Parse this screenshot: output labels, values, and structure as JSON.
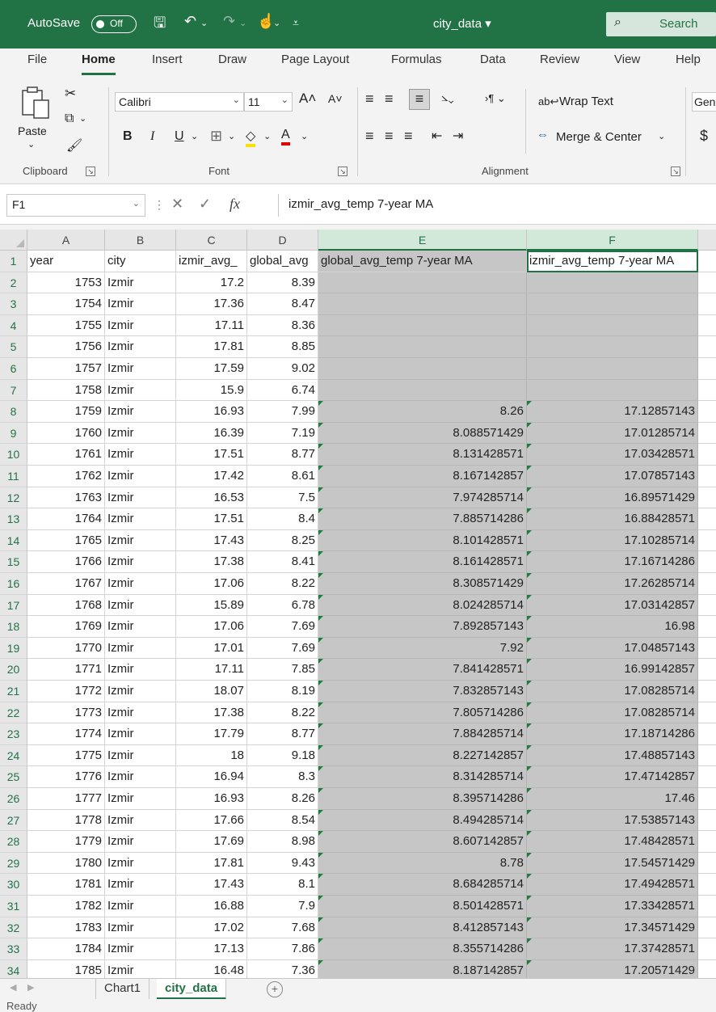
{
  "titlebar": {
    "autosave_label": "AutoSave",
    "autosave_state": "Off",
    "filename": "city_data",
    "search_label": "Search"
  },
  "menu": [
    "File",
    "Home",
    "Insert",
    "Draw",
    "Page Layout",
    "Formulas",
    "Data",
    "Review",
    "View",
    "Help"
  ],
  "ribbon": {
    "paste_label": "Paste",
    "clipboard_label": "Clipboard",
    "font_name": "Calibri",
    "font_size": "11",
    "font_label": "Font",
    "bold": "B",
    "italic": "I",
    "underline": "U",
    "wrap_text": "Wrap Text",
    "merge_center": "Merge & Center",
    "alignment_label": "Alignment",
    "number_format_partial": "Gen",
    "currency_symbol": "$"
  },
  "formula_bar": {
    "name_box": "F1",
    "formula": "izmir_avg_temp 7-year MA"
  },
  "columns": [
    "A",
    "B",
    "C",
    "D",
    "E",
    "F"
  ],
  "header_row": [
    "year",
    "city",
    "izmir_avg_",
    "global_avg",
    "global_avg_temp 7-year MA",
    "izmir_avg_temp 7-year MA"
  ],
  "rows": [
    {
      "n": "2",
      "year": "1753",
      "city": "Izmir",
      "izmir": "17.2",
      "global": "8.39",
      "gma": "",
      "ima": ""
    },
    {
      "n": "3",
      "year": "1754",
      "city": "Izmir",
      "izmir": "17.36",
      "global": "8.47",
      "gma": "",
      "ima": ""
    },
    {
      "n": "4",
      "year": "1755",
      "city": "Izmir",
      "izmir": "17.11",
      "global": "8.36",
      "gma": "",
      "ima": ""
    },
    {
      "n": "5",
      "year": "1756",
      "city": "Izmir",
      "izmir": "17.81",
      "global": "8.85",
      "gma": "",
      "ima": ""
    },
    {
      "n": "6",
      "year": "1757",
      "city": "Izmir",
      "izmir": "17.59",
      "global": "9.02",
      "gma": "",
      "ima": ""
    },
    {
      "n": "7",
      "year": "1758",
      "city": "Izmir",
      "izmir": "15.9",
      "global": "6.74",
      "gma": "",
      "ima": ""
    },
    {
      "n": "8",
      "year": "1759",
      "city": "Izmir",
      "izmir": "16.93",
      "global": "7.99",
      "gma": "8.26",
      "ima": "17.12857143"
    },
    {
      "n": "9",
      "year": "1760",
      "city": "Izmir",
      "izmir": "16.39",
      "global": "7.19",
      "gma": "8.088571429",
      "ima": "17.01285714"
    },
    {
      "n": "10",
      "year": "1761",
      "city": "Izmir",
      "izmir": "17.51",
      "global": "8.77",
      "gma": "8.131428571",
      "ima": "17.03428571"
    },
    {
      "n": "11",
      "year": "1762",
      "city": "Izmir",
      "izmir": "17.42",
      "global": "8.61",
      "gma": "8.167142857",
      "ima": "17.07857143"
    },
    {
      "n": "12",
      "year": "1763",
      "city": "Izmir",
      "izmir": "16.53",
      "global": "7.5",
      "gma": "7.974285714",
      "ima": "16.89571429"
    },
    {
      "n": "13",
      "year": "1764",
      "city": "Izmir",
      "izmir": "17.51",
      "global": "8.4",
      "gma": "7.885714286",
      "ima": "16.88428571"
    },
    {
      "n": "14",
      "year": "1765",
      "city": "Izmir",
      "izmir": "17.43",
      "global": "8.25",
      "gma": "8.101428571",
      "ima": "17.10285714"
    },
    {
      "n": "15",
      "year": "1766",
      "city": "Izmir",
      "izmir": "17.38",
      "global": "8.41",
      "gma": "8.161428571",
      "ima": "17.16714286"
    },
    {
      "n": "16",
      "year": "1767",
      "city": "Izmir",
      "izmir": "17.06",
      "global": "8.22",
      "gma": "8.308571429",
      "ima": "17.26285714"
    },
    {
      "n": "17",
      "year": "1768",
      "city": "Izmir",
      "izmir": "15.89",
      "global": "6.78",
      "gma": "8.024285714",
      "ima": "17.03142857"
    },
    {
      "n": "18",
      "year": "1769",
      "city": "Izmir",
      "izmir": "17.06",
      "global": "7.69",
      "gma": "7.892857143",
      "ima": "16.98"
    },
    {
      "n": "19",
      "year": "1770",
      "city": "Izmir",
      "izmir": "17.01",
      "global": "7.69",
      "gma": "7.92",
      "ima": "17.04857143"
    },
    {
      "n": "20",
      "year": "1771",
      "city": "Izmir",
      "izmir": "17.11",
      "global": "7.85",
      "gma": "7.841428571",
      "ima": "16.99142857"
    },
    {
      "n": "21",
      "year": "1772",
      "city": "Izmir",
      "izmir": "18.07",
      "global": "8.19",
      "gma": "7.832857143",
      "ima": "17.08285714"
    },
    {
      "n": "22",
      "year": "1773",
      "city": "Izmir",
      "izmir": "17.38",
      "global": "8.22",
      "gma": "7.805714286",
      "ima": "17.08285714"
    },
    {
      "n": "23",
      "year": "1774",
      "city": "Izmir",
      "izmir": "17.79",
      "global": "8.77",
      "gma": "7.884285714",
      "ima": "17.18714286"
    },
    {
      "n": "24",
      "year": "1775",
      "city": "Izmir",
      "izmir": "18",
      "global": "9.18",
      "gma": "8.227142857",
      "ima": "17.48857143"
    },
    {
      "n": "25",
      "year": "1776",
      "city": "Izmir",
      "izmir": "16.94",
      "global": "8.3",
      "gma": "8.314285714",
      "ima": "17.47142857"
    },
    {
      "n": "26",
      "year": "1777",
      "city": "Izmir",
      "izmir": "16.93",
      "global": "8.26",
      "gma": "8.395714286",
      "ima": "17.46"
    },
    {
      "n": "27",
      "year": "1778",
      "city": "Izmir",
      "izmir": "17.66",
      "global": "8.54",
      "gma": "8.494285714",
      "ima": "17.53857143"
    },
    {
      "n": "28",
      "year": "1779",
      "city": "Izmir",
      "izmir": "17.69",
      "global": "8.98",
      "gma": "8.607142857",
      "ima": "17.48428571"
    },
    {
      "n": "29",
      "year": "1780",
      "city": "Izmir",
      "izmir": "17.81",
      "global": "9.43",
      "gma": "8.78",
      "ima": "17.54571429"
    },
    {
      "n": "30",
      "year": "1781",
      "city": "Izmir",
      "izmir": "17.43",
      "global": "8.1",
      "gma": "8.684285714",
      "ima": "17.49428571"
    },
    {
      "n": "31",
      "year": "1782",
      "city": "Izmir",
      "izmir": "16.88",
      "global": "7.9",
      "gma": "8.501428571",
      "ima": "17.33428571"
    },
    {
      "n": "32",
      "year": "1783",
      "city": "Izmir",
      "izmir": "17.02",
      "global": "7.68",
      "gma": "8.412857143",
      "ima": "17.34571429"
    },
    {
      "n": "33",
      "year": "1784",
      "city": "Izmir",
      "izmir": "17.13",
      "global": "7.86",
      "gma": "8.355714286",
      "ima": "17.37428571"
    },
    {
      "n": "34",
      "year": "1785",
      "city": "Izmir",
      "izmir": "16.48",
      "global": "7.36",
      "gma": "8.187142857",
      "ima": "17.20571429"
    }
  ],
  "sheet_tabs": [
    "Chart1",
    "city_data"
  ],
  "active_sheet": "city_data",
  "status": "Ready",
  "colors": {
    "accent": "#217346",
    "selection_shade": "#c6c6c6"
  }
}
